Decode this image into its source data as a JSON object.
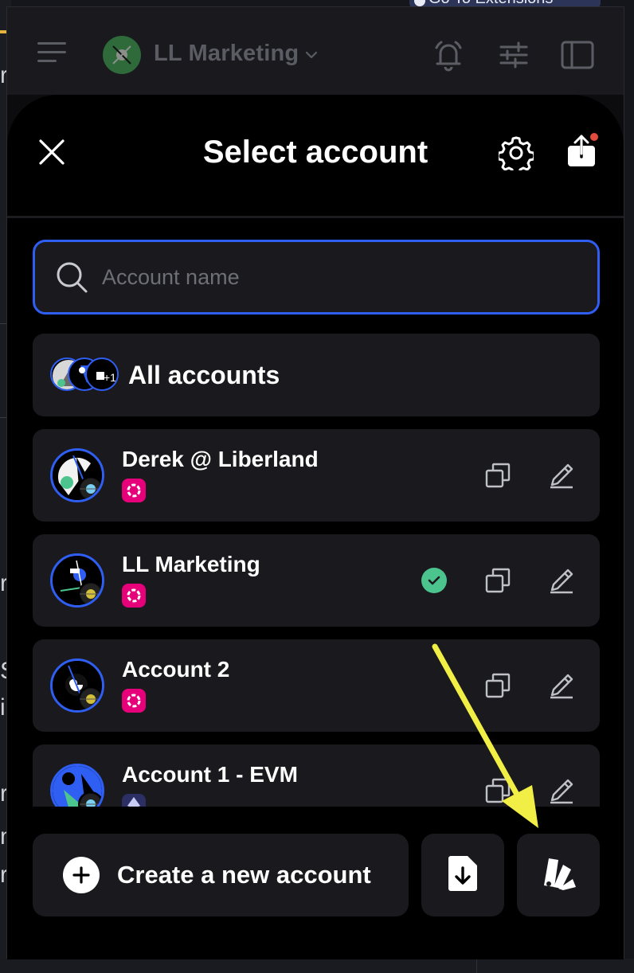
{
  "background": {
    "tab_label": "Go To Extensions"
  },
  "header": {
    "context_name": "LL Marketing"
  },
  "modal": {
    "title": "Select account",
    "search_placeholder": "Account name",
    "all_accounts_label": "All accounts",
    "accounts": [
      {
        "name": "Derek @ Liberland",
        "chain": "polkadot-icon",
        "selected": false
      },
      {
        "name": "LL Marketing",
        "chain": "polkadot-icon",
        "selected": true
      },
      {
        "name": "Account 2",
        "chain": "polkadot-icon",
        "selected": false
      },
      {
        "name": "Account 1 - EVM",
        "chain": "ethereum-icon",
        "selected": false
      }
    ],
    "create_label": "Create a new account"
  },
  "colors": {
    "accent_blue": "#2f5ef2",
    "polkadot_pink": "#e6007a",
    "selected_green": "#4cc48e",
    "annotation_yellow": "#f1ee45",
    "notification_red": "#e24b3d"
  }
}
